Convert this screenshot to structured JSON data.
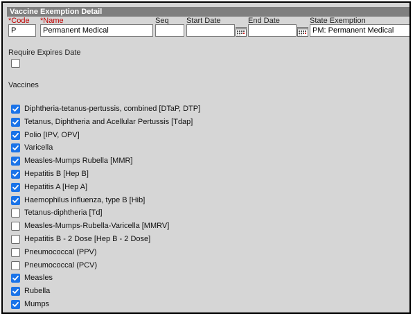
{
  "panel": {
    "title": "Vaccine Exemption Detail"
  },
  "fields": {
    "code": {
      "required_mark": "*",
      "label": "Code",
      "value": "P"
    },
    "name": {
      "required_mark": "*",
      "label": "Name",
      "value": "Permanent Medical"
    },
    "seq": {
      "label": "Seq",
      "value": ""
    },
    "start_date": {
      "label": "Start Date",
      "value": ""
    },
    "end_date": {
      "label": "End Date",
      "value": ""
    },
    "state_exemption": {
      "label": "State Exemption",
      "value": "PM: Permanent Medical"
    }
  },
  "require_expires": {
    "label": "Require Expires Date",
    "checked": false
  },
  "vaccines_heading": "Vaccines",
  "vaccines": [
    {
      "label": "Diphtheria-tetanus-pertussis, combined [DTaP, DTP]",
      "checked": true
    },
    {
      "label": "Tetanus, Diphtheria and Acellular Pertussis [Tdap]",
      "checked": true
    },
    {
      "label": "Polio [IPV, OPV]",
      "checked": true
    },
    {
      "label": "Varicella",
      "checked": true
    },
    {
      "label": "Measles-Mumps Rubella [MMR]",
      "checked": true
    },
    {
      "label": "Hepatitis B [Hep B]",
      "checked": true
    },
    {
      "label": "Hepatitis A [Hep A]",
      "checked": true
    },
    {
      "label": "Haemophilus influenza, type B [Hib]",
      "checked": true
    },
    {
      "label": "Tetanus-diphtheria [Td]",
      "checked": false
    },
    {
      "label": "Measles-Mumps-Rubella-Varicella [MMRV]",
      "checked": false
    },
    {
      "label": "Hepatitis B - 2 Dose [Hep B - 2 Dose]",
      "checked": false
    },
    {
      "label": "Pneumococcal (PPV)",
      "checked": false
    },
    {
      "label": "Pneumococcal (PCV)",
      "checked": false
    },
    {
      "label": "Measles",
      "checked": true
    },
    {
      "label": "Rubella",
      "checked": true
    },
    {
      "label": "Mumps",
      "checked": true
    }
  ],
  "colors": {
    "header_bg": "#7f7f7f",
    "panel_bg": "#d6d6d6",
    "required": "#c00000",
    "checkbox_accent": "#1a73e8"
  }
}
